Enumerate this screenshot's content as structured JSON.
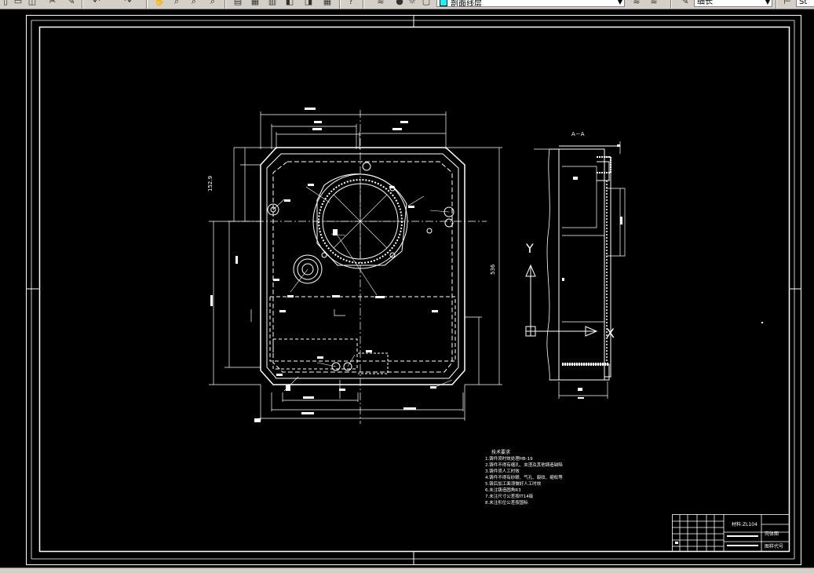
{
  "toolbar": {
    "layer_combo_value": "剖面线层",
    "linetype_combo_value": "细长",
    "right_combo_value": "St"
  },
  "drawing": {
    "section_label": "A－A",
    "overall_height_dim": "536",
    "left_height_dim": "152.9",
    "axis_y": "Y",
    "axis_x": "X",
    "notes_title": "技术要求",
    "notes": [
      "1.铸件须时效处理HB-19",
      "2.铸件不得有缩孔、夹渣及其他铸造缺陷",
      "3.铸件须人工时效",
      "4.铸件不得有砂眼、气孔、裂纹、缩松等",
      "5.铸后加工面须做好人工时效",
      "6.未注铸造圆角R3",
      "7.未注尺寸公差按IT14级",
      "8.未注形位公差按国标"
    ],
    "title_block": {
      "material": "材料:ZL104",
      "drawing_name": "壳体图",
      "drawing_number": "图样代号"
    }
  }
}
